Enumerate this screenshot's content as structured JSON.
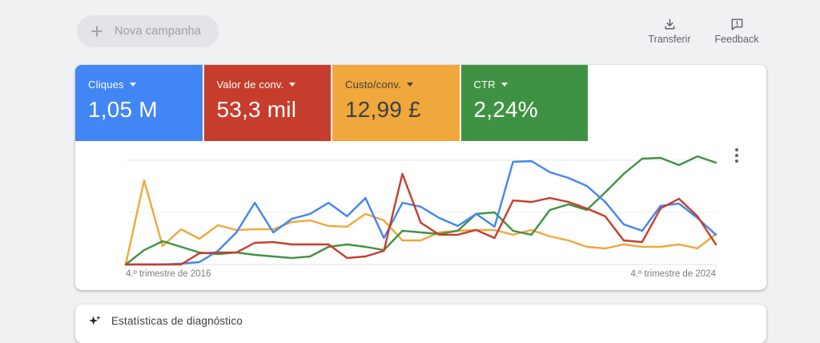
{
  "toolbar": {
    "new_campaign_label": "Nova campanha",
    "download_label": "Transferir",
    "feedback_label": "Feedback"
  },
  "scorecards": [
    {
      "label": "Cliques",
      "value": "1,05 M",
      "color": "#4285f4",
      "text_color": "#ffffff"
    },
    {
      "label": "Valor de conv.",
      "value": "53,3 mil",
      "color": "#c63d2d",
      "text_color": "#ffffff"
    },
    {
      "label": "Custo/conv.",
      "value": "12,99 £",
      "color": "#f0a73c",
      "text_color": "#3c4043"
    },
    {
      "label": "CTR",
      "value": "2,24%",
      "color": "#3f9243",
      "text_color": "#ffffff"
    }
  ],
  "chart_data": {
    "type": "line",
    "x_start_label": "4.º trimestre de 2016",
    "x_end_label": "4.º trimestre de 2024",
    "x_unit": "quarter",
    "n_points": 33,
    "ylim": [
      0,
      105
    ],
    "grid": "horizontal",
    "legend": "none",
    "series": [
      {
        "name": "Cliques",
        "color": "#4285f4",
        "values": [
          0,
          0,
          0,
          0.8,
          2.3,
          13.1,
          30.8,
          59.2,
          30.8,
          43.8,
          48.5,
          59.2,
          46.2,
          63.8,
          25.4,
          59.2,
          55.4,
          44.6,
          36.9,
          48.5,
          36.2,
          98.5,
          99.2,
          88.5,
          83.1,
          75.4,
          60,
          38.5,
          32.3,
          56.2,
          58.5,
          44.6,
          28.5
        ]
      },
      {
        "name": "Valor de conv.",
        "color": "#c63d2d",
        "values": [
          0,
          0,
          0,
          0,
          10.8,
          11.5,
          11.5,
          20.8,
          21.5,
          19.2,
          19.2,
          19.2,
          6.2,
          7.7,
          13.1,
          86.9,
          40,
          28.5,
          28.5,
          33.1,
          25.4,
          61.5,
          60,
          63.8,
          60,
          53.8,
          46.2,
          23.1,
          21.5,
          53.8,
          63.1,
          46.2,
          19.2
        ]
      },
      {
        "name": "Custo/conv.",
        "color": "#f0a73c",
        "values": [
          0,
          80.8,
          17.7,
          33.8,
          24.6,
          37.7,
          33.1,
          33.8,
          33.8,
          40.8,
          42.3,
          36.9,
          36.2,
          48.5,
          42.3,
          23.1,
          23.1,
          30.8,
          32.3,
          33.1,
          33.1,
          28.5,
          33.1,
          26.9,
          23.1,
          16.9,
          15.4,
          19.2,
          16.9,
          16.9,
          19.2,
          15.4,
          29.2
        ]
      },
      {
        "name": "CTR",
        "color": "#3f9243",
        "values": [
          0,
          13.8,
          22.3,
          16.9,
          11.5,
          10,
          11.5,
          9.2,
          7.7,
          6.2,
          7.7,
          16.9,
          19.2,
          16.9,
          13.8,
          32.3,
          30.8,
          29.2,
          32.3,
          48.5,
          50,
          32.3,
          28.5,
          52.3,
          57.7,
          52.3,
          69.2,
          86.9,
          101.5,
          102.3,
          95.4,
          103.8,
          97.7
        ]
      }
    ]
  },
  "diagnostics_card": {
    "title": "Estatísticas de diagnóstico"
  }
}
